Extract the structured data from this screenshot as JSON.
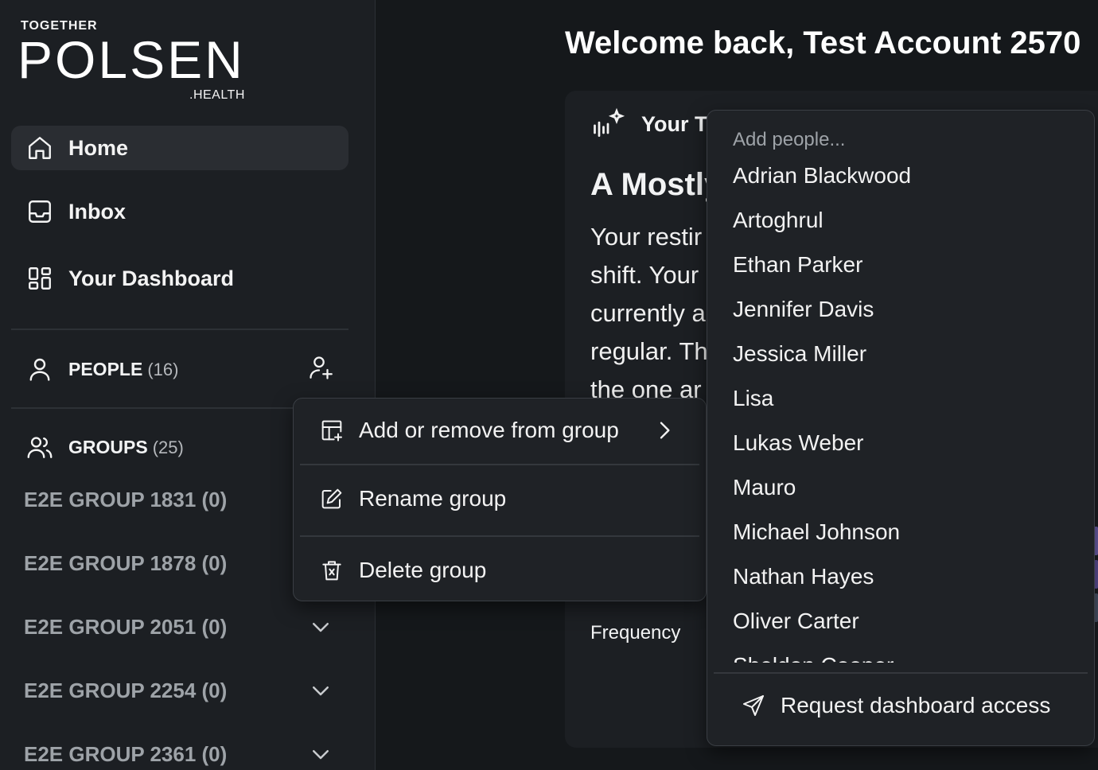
{
  "logo": {
    "tagline": "TOGETHER",
    "wordmark": "POLSEN",
    "suffix": ".HEALTH"
  },
  "nav": {
    "items": [
      {
        "label": "Home",
        "icon": "home-icon",
        "active": true
      },
      {
        "label": "Inbox",
        "icon": "inbox-icon",
        "active": false
      },
      {
        "label": "Your Dashboard",
        "icon": "dashboard-icon",
        "active": false
      }
    ]
  },
  "people_section": {
    "label": "PEOPLE",
    "count": "(16)"
  },
  "groups_section": {
    "label": "GROUPS",
    "count": "(25)"
  },
  "groups": [
    {
      "label": "E2E GROUP 1831 (0)"
    },
    {
      "label": "E2E GROUP 1878 (0)"
    },
    {
      "label": "E2E GROUP 2051 (0)"
    },
    {
      "label": "E2E GROUP 2254 (0)"
    },
    {
      "label": "E2E GROUP 2361 (0)"
    }
  ],
  "main": {
    "welcome": "Welcome back, Test Account 2570",
    "card_header": "Your T",
    "card_title": "A Mostly",
    "card_body": [
      "Your restir",
      "shift. Your",
      "currently a",
      "regular. Th",
      "the one ar"
    ],
    "frequency_label": "Frequency"
  },
  "context_menu": {
    "items": [
      {
        "label": "Add or remove from group",
        "icon": "table-add-icon",
        "submenu": true
      },
      {
        "label": "Rename group",
        "icon": "pencil-icon",
        "submenu": false
      },
      {
        "label": "Delete group",
        "icon": "trash-icon",
        "submenu": false
      }
    ]
  },
  "people_dropdown": {
    "search_placeholder": "Add people...",
    "people": [
      "Adrian Blackwood",
      "Artoghrul",
      "Ethan Parker",
      "Jennifer Davis",
      "Jessica Miller",
      "Lisa",
      "Lukas Weber",
      "Mauro",
      "Michael Johnson",
      "Nathan Hayes",
      "Oliver Carter",
      "Sheldon Cooper"
    ],
    "request_label": "Request dashboard access"
  },
  "colors": {
    "background": "#15181b",
    "sidebar": "#1c1f23",
    "panel": "#1f2226",
    "accent_bars": [
      "#6b5ea8",
      "#5d4f96",
      "#4a5468"
    ]
  }
}
